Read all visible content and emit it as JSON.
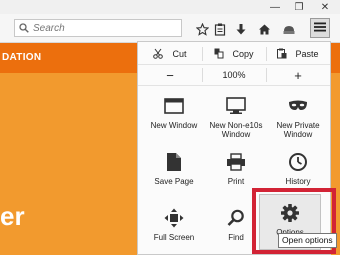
{
  "window": {
    "minimize": "—",
    "restore": "❐",
    "close": "✕"
  },
  "toolbar": {
    "search_placeholder": "Search",
    "icons": [
      "bookmark-star-icon",
      "reading-list-icon",
      "download-icon",
      "home-icon",
      "extension-icon",
      "hamburger-menu-icon"
    ]
  },
  "page": {
    "banner_text": "DATION",
    "big_text": "er"
  },
  "menu": {
    "edit": {
      "cut": "Cut",
      "copy": "Copy",
      "paste": "Paste"
    },
    "zoom": {
      "minus": "−",
      "value": "100%",
      "plus": "+"
    },
    "items": [
      {
        "label": "New Window",
        "icon": "new-window-icon"
      },
      {
        "label": "New Non-e10s Window",
        "icon": "monitor-icon"
      },
      {
        "label": "New Private Window",
        "icon": "private-mask-icon"
      },
      {
        "label": "Save Page",
        "icon": "save-page-icon"
      },
      {
        "label": "Print",
        "icon": "printer-icon"
      },
      {
        "label": "History",
        "icon": "history-clock-icon"
      },
      {
        "label": "Full Screen",
        "icon": "fullscreen-icon"
      },
      {
        "label": "Find",
        "icon": "magnifier-icon"
      },
      {
        "label": "Options",
        "icon": "gear-icon"
      }
    ]
  },
  "tooltip": "Open options",
  "colors": {
    "highlight": "#d22335",
    "page_orange": "#f29a2e",
    "banner_orange": "#ec6f0d"
  }
}
